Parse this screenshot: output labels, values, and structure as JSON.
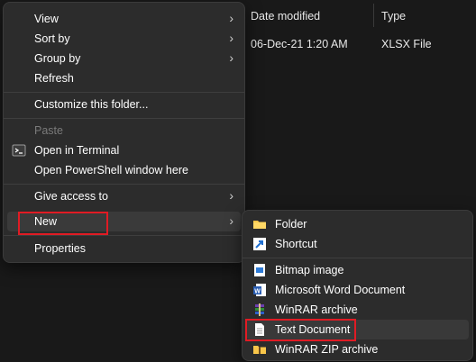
{
  "explorer": {
    "col_date_modified": "Date modified",
    "col_type": "Type",
    "row_date": "06-Dec-21 1:20 AM",
    "row_type": "XLSX File"
  },
  "context_menu": {
    "view": "View",
    "sort_by": "Sort by",
    "group_by": "Group by",
    "refresh": "Refresh",
    "customize": "Customize this folder...",
    "paste": "Paste",
    "open_terminal": "Open in Terminal",
    "open_powershell": "Open PowerShell window here",
    "give_access": "Give access to",
    "new": "New",
    "properties": "Properties"
  },
  "new_submenu": {
    "folder": "Folder",
    "shortcut": "Shortcut",
    "bitmap": "Bitmap image",
    "word": "Microsoft Word Document",
    "winrar": "WinRAR archive",
    "text": "Text Document",
    "winrar_zip": "WinRAR ZIP archive"
  },
  "colors": {
    "highlight": "#e01b24",
    "menu_bg": "#2c2c2c",
    "window_bg": "#191919"
  }
}
